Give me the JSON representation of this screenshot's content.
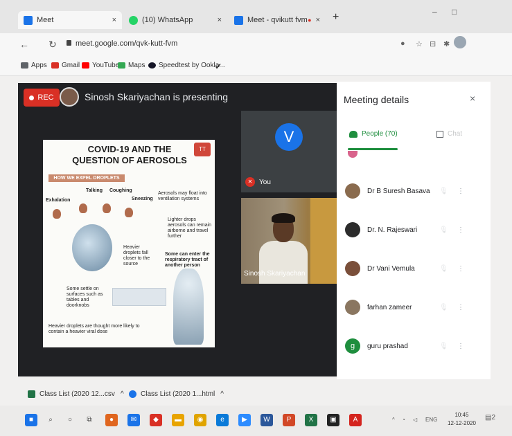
{
  "browser": {
    "tabs": [
      {
        "label": "Meet",
        "close": "×",
        "color": "#1a73e8"
      },
      {
        "label": "(10) WhatsApp",
        "close": "×",
        "color": "#25d366"
      },
      {
        "label": "Meet - qvikutt fvm",
        "close": "×",
        "color": "#1a73e8"
      }
    ],
    "tab_record_mark": "●",
    "new_tab": "+",
    "win_min": "–",
    "win_max": "□",
    "url": "meet.google.com/qvk-kutt-fvm",
    "bookmarks": [
      {
        "label": "Apps",
        "color": "#5f6368"
      },
      {
        "label": "Gmail",
        "color": "#d93025"
      },
      {
        "label": "YouTube",
        "color": "#ff0000"
      },
      {
        "label": "Maps",
        "color": "#34a853"
      },
      {
        "label": "Speedtest by Ookla...",
        "color": "#141526"
      }
    ]
  },
  "meet": {
    "rec_label": "REC",
    "presenting_text": "Sinosh Skariyachan is presenting",
    "self_initial": "V",
    "self_label": "You",
    "mute_glyph": "✕",
    "camera_name": "Sinosh Skariyachan"
  },
  "slide": {
    "title": "COVID-19 AND THE QUESTION OF AEROSOLS",
    "logo": "TT",
    "banner": "HOW WE EXPEL DROPLETS",
    "labels": {
      "talking": "Talking",
      "coughing": "Coughing",
      "exhalation": "Exhalation",
      "sneezing": "Sneezing",
      "aerosols": "Aerosols may float into ventilation systems",
      "lighter": "Lighter drops aerosols can remain airborne and travel further",
      "heavier": "Heavier droplets fall closer to the source",
      "settle": "Some settle on surfaces such as tables and doorknobs",
      "enter": "Some can enter the respiratory tract of another person",
      "footer": "Heavier droplets are thought more likely to contain a heavier viral dose"
    }
  },
  "panel": {
    "title": "Meeting details",
    "close": "×",
    "people_tab": "People (70)",
    "chat_tab": "Chat",
    "mic_glyph": "🎙",
    "more_glyph": "⋮",
    "people": [
      {
        "name": "Dr B Suresh Basava",
        "initial": "",
        "color": "#8a6b4e"
      },
      {
        "name": "Dr. N. Rajeswari",
        "initial": "",
        "color": "#2c2c2c"
      },
      {
        "name": "Dr Vani Vemula",
        "initial": "",
        "color": "#7a4f3a"
      },
      {
        "name": "farhan zameer",
        "initial": "",
        "color": "#8a7660"
      },
      {
        "name": "guru prashad",
        "initial": "g",
        "color": "#1e8e3e"
      }
    ]
  },
  "downloads": [
    {
      "label": "Class List (2020 12...csv",
      "more": "^",
      "color": "#217346"
    },
    {
      "label": "Class List (2020 1...html",
      "more": "^",
      "color": "#1a73e8"
    }
  ],
  "taskbar": {
    "items": [
      {
        "name": "windows-start",
        "color": "#1a73e8",
        "glyph": "■"
      },
      {
        "name": "search",
        "color": "#444",
        "glyph": "⌕"
      },
      {
        "name": "cortana",
        "color": "#444",
        "glyph": "○"
      },
      {
        "name": "task-view",
        "color": "#444",
        "glyph": "⧉"
      },
      {
        "name": "app-photos",
        "color": "#e0661f",
        "glyph": "●"
      },
      {
        "name": "app-mail",
        "color": "#1a73e8",
        "glyph": "✉"
      },
      {
        "name": "app-maps",
        "color": "#d93025",
        "glyph": "◆"
      },
      {
        "name": "app-files",
        "color": "#e8a400",
        "glyph": "▬"
      },
      {
        "name": "app-chrome",
        "color": "#e0a400",
        "glyph": "◉"
      },
      {
        "name": "app-edge",
        "color": "#0a7ad8",
        "glyph": "e"
      },
      {
        "name": "app-zoom",
        "color": "#2d8cff",
        "glyph": "▶"
      },
      {
        "name": "app-word",
        "color": "#2b579a",
        "glyph": "W"
      },
      {
        "name": "app-powerpoint",
        "color": "#d24726",
        "glyph": "P"
      },
      {
        "name": "app-excel",
        "color": "#217346",
        "glyph": "X"
      },
      {
        "name": "app-store",
        "color": "#222",
        "glyph": "▣"
      },
      {
        "name": "app-acrobat",
        "color": "#d4241e",
        "glyph": "A"
      }
    ],
    "tray_lang": "ENG",
    "time": "10:45",
    "date": "12-12-2020",
    "notif_count": "2"
  }
}
